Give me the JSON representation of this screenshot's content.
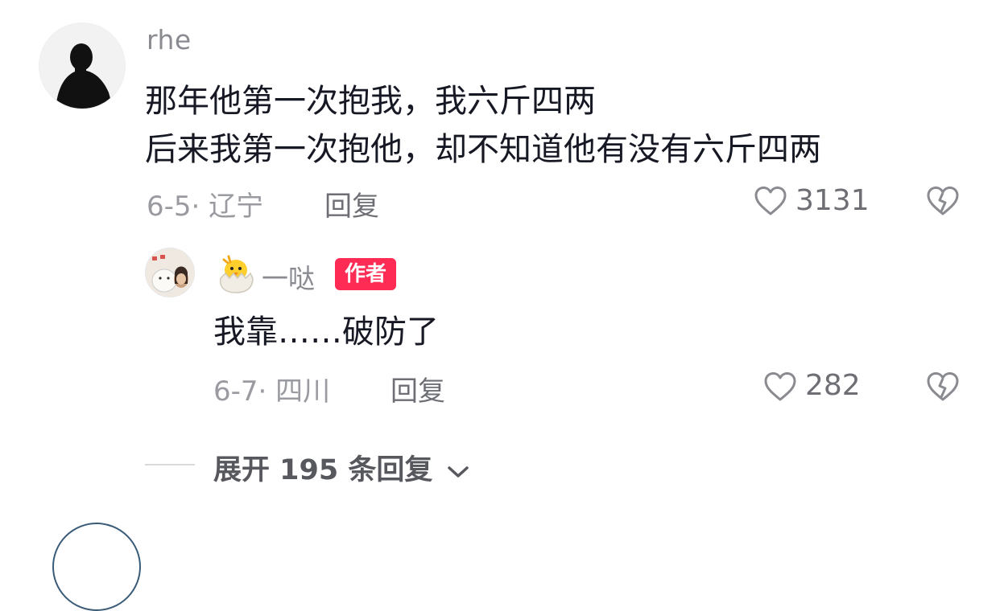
{
  "comment": {
    "username": "rhe",
    "lines": [
      "那年他第一次抱我，我六斤四两",
      "后来我第一次抱他，却不知道他有没有六斤四两"
    ],
    "date_location": "6-5· 辽宁",
    "reply_label": "回复",
    "likes": "3131"
  },
  "reply": {
    "username": "一哒",
    "badge": "作者",
    "text": "我靠……破防了",
    "date_location": "6-7· 四川",
    "reply_label": "回复",
    "likes": "282"
  },
  "expand": {
    "label": "展开 195 条回复"
  },
  "colors": {
    "badge": "#fe2c55",
    "text": "#161823",
    "secondary": "#8a8b91"
  }
}
